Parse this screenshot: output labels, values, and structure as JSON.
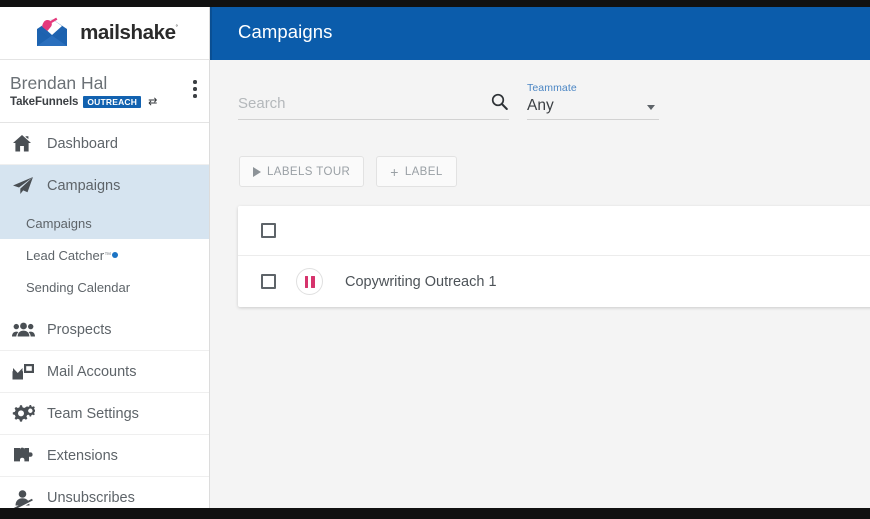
{
  "brand": {
    "logo_word": "mailshake",
    "logo_tm": "˚",
    "logo_icon": "envelope-logo",
    "header_blue": "#0b5cab",
    "accent_pink": "#d6336c",
    "highlight_blue": "#d6e4f0"
  },
  "header": {
    "title": "Campaigns"
  },
  "user": {
    "name": "Brendan Hal",
    "team": "TakeFunnels",
    "badge": "OUTREACH",
    "switch_icon": "⇄",
    "menu_icon": "kebab-menu-icon"
  },
  "sidebar": {
    "items": [
      {
        "label": "Dashboard",
        "icon": "home-icon",
        "active": false
      },
      {
        "label": "Campaigns",
        "icon": "paper-plane-icon",
        "active": true
      },
      {
        "label": "Prospects",
        "icon": "people-group-icon",
        "active": false
      },
      {
        "label": "Mail Accounts",
        "icon": "mail-accounts-icon",
        "active": false
      },
      {
        "label": "Team Settings",
        "icon": "gears-icon",
        "active": false
      },
      {
        "label": "Extensions",
        "icon": "puzzle-piece-icon",
        "active": false
      },
      {
        "label": "Unsubscribes",
        "icon": "person-slash-icon",
        "active": false
      }
    ],
    "subitems": [
      {
        "label": "Campaigns",
        "tm": "",
        "dot": false,
        "active": true
      },
      {
        "label": "Lead Catcher",
        "tm": "™",
        "dot": true,
        "active": false
      },
      {
        "label": "Sending Calendar",
        "tm": "",
        "dot": false,
        "active": false
      }
    ]
  },
  "filters": {
    "search_placeholder": "Search",
    "search_value": "",
    "search_icon": "search-icon",
    "teammate_label": "Teammate",
    "teammate_value": "Any",
    "teammate_options": [
      "Any"
    ]
  },
  "toolbar": {
    "labels_tour": "LABELS TOUR",
    "add_label": "+ LABEL",
    "add_label_text": "LABEL",
    "plus": "+"
  },
  "campaign_list": {
    "rows": [
      {
        "name": "Copywriting Outreach 1",
        "status_icon": "pause-icon",
        "checked": false
      }
    ],
    "select_all_checked": false
  }
}
